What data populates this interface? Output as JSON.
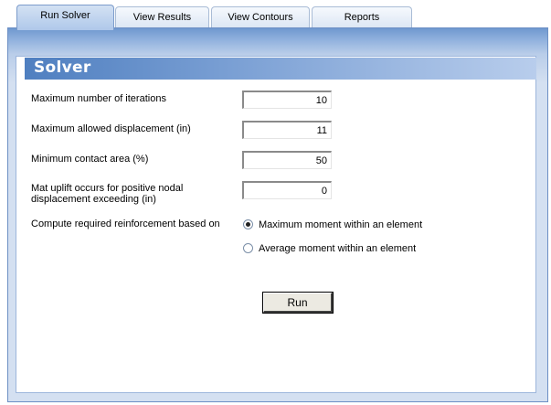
{
  "tabs": [
    {
      "label": "Run Solver",
      "active": true
    },
    {
      "label": "View Results",
      "active": false
    },
    {
      "label": "View Contours",
      "active": false
    },
    {
      "label": "Reports",
      "active": false
    }
  ],
  "section": {
    "title": "Solver"
  },
  "fields": [
    {
      "label": "Maximum number of iterations",
      "value": "10"
    },
    {
      "label": "Maximum allowed displacement (in)",
      "value": "11"
    },
    {
      "label": "Minimum contact area (%)",
      "value": "50"
    },
    {
      "label_line1": "Mat uplift occurs for positive nodal",
      "label_line2": "displacement exceeding (in)",
      "value": "0"
    }
  ],
  "reinforcement": {
    "label": "Compute required reinforcement based on",
    "options": [
      {
        "label": "Maximum moment within an element",
        "selected": true
      },
      {
        "label": "Average moment within an element",
        "selected": false
      }
    ]
  },
  "run_button": {
    "label": "Run"
  },
  "colors": {
    "header_blue": "#4f7fc0",
    "frame_blue": "#6f98cf",
    "panel_bg": "#d4e0f1"
  }
}
